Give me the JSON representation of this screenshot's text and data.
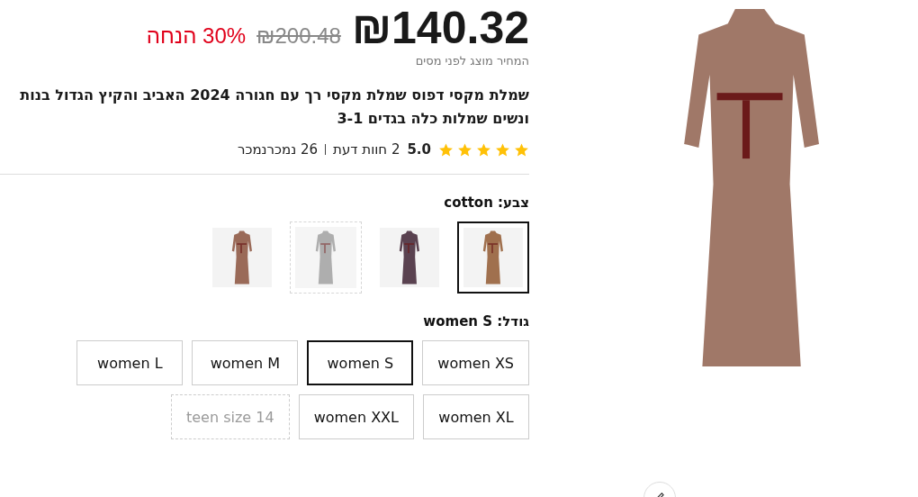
{
  "price": {
    "current": "₪140.32",
    "original": "₪200.48",
    "discount": "30% הנחה",
    "tax_note": "המחיר מוצג לפני מסים"
  },
  "title": "שמלת מקסי דפוס שמלת מקסי רך עם חגורה 2024 האביב והקיץ הגדול בנות ונשים שמלות כלה בגדים 3-1",
  "rating": {
    "stars": 5,
    "score": "5.0",
    "reviews": "2 חוות דעת",
    "sold": "26 נמכרנמכר"
  },
  "color": {
    "label": "צבע:",
    "value": "cotton",
    "swatches": [
      {
        "selected": true,
        "available": true
      },
      {
        "selected": false,
        "available": true
      },
      {
        "selected": false,
        "available": false
      },
      {
        "selected": false,
        "available": true
      }
    ]
  },
  "size": {
    "label": "גודל:",
    "value": "women S",
    "options": [
      {
        "label": "women XS",
        "selected": false,
        "disabled": false
      },
      {
        "label": "women S",
        "selected": true,
        "disabled": false
      },
      {
        "label": "women M",
        "selected": false,
        "disabled": false
      },
      {
        "label": "women L",
        "selected": false,
        "disabled": false
      },
      {
        "label": "women XL",
        "selected": false,
        "disabled": false
      },
      {
        "label": "women XXL",
        "selected": false,
        "disabled": false
      },
      {
        "label": "teen size 14",
        "selected": false,
        "disabled": true
      }
    ]
  }
}
